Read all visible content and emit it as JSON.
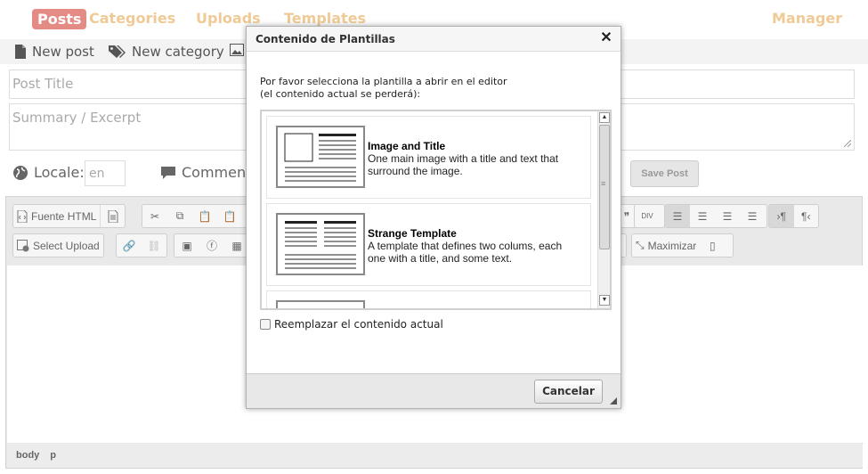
{
  "nav": {
    "posts": "Posts",
    "categories": "Categories",
    "uploads": "Uploads",
    "templates": "Templates",
    "manager": "Manager",
    "active_color": "#e48b86",
    "inactive_color": "#f0ca96"
  },
  "actions": {
    "new_post": "New post",
    "new_category": "New category"
  },
  "form": {
    "title_placeholder": "Post Title",
    "summary_placeholder": "Summary / Excerpt",
    "locale_label": "Locale:",
    "locale_value": "en",
    "comments_label": "Comments",
    "save_label": "Save Post"
  },
  "editor": {
    "source_label": "Fuente HTML",
    "select_upload_label": "Select Upload",
    "maximize_label": "Maximizar",
    "status_path": [
      "body",
      "p"
    ]
  },
  "dialog": {
    "title": "Contenido de Plantillas",
    "instruction_line1": "Por favor selecciona la plantilla a abrir en el editor",
    "instruction_line2": "(el contenido actual se perderá):",
    "templates": [
      {
        "name": "Image and Title",
        "description": "One main image with a title and text that surround the image."
      },
      {
        "name": "Strange Template",
        "description": "A template that defines two colums, each one with a title, and some text."
      }
    ],
    "replace_label": "Reemplazar el contenido actual",
    "cancel_label": "Cancelar"
  }
}
